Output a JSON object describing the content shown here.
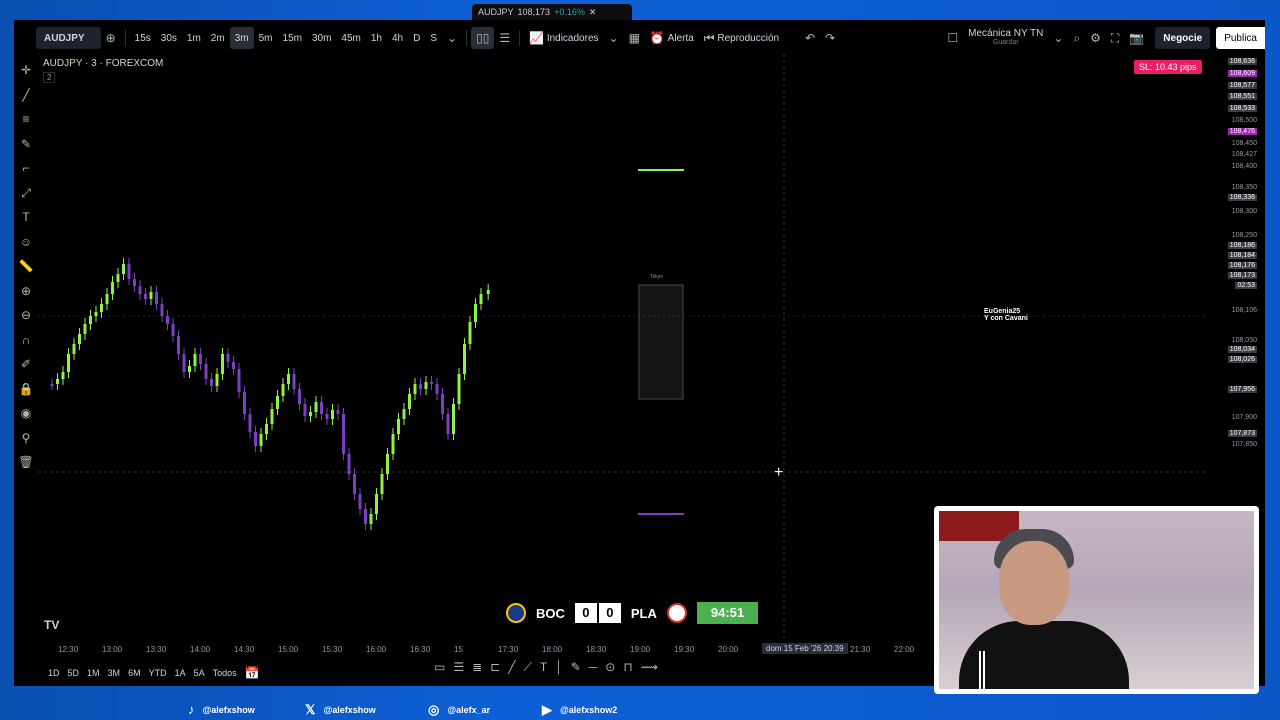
{
  "browser_tab": {
    "symbol": "AUDJPY",
    "price": "108,173",
    "change": "+0.16%"
  },
  "toolbar": {
    "symbol": "AUDJPY",
    "intervals": [
      "15s",
      "30s",
      "1m",
      "2m",
      "3m",
      "5m",
      "15m",
      "30m",
      "45m",
      "1h",
      "4h",
      "D",
      "S"
    ],
    "active_interval": "3m",
    "indicators_label": "Indicadores",
    "alert_label": "Alerta",
    "replay_label": "Reproducción",
    "layout_name": "Mecánica NY TN",
    "layout_sub": "Guardar",
    "trade_label": "Negocie",
    "publish_label": "Publica"
  },
  "chart": {
    "title": "AUDJPY · 3 · FOREXCOM",
    "sub": "2",
    "sl_badge": "SL: 10.43 pips",
    "watermark": "TV",
    "user_label": "EuGenia25",
    "user_label2": "Y con Cavani",
    "box_label": "Tokyo",
    "cursor_date": "dom 15 Feb '26  20:39"
  },
  "price_axis": [
    {
      "label": "108,636",
      "style": "box"
    },
    {
      "label": "108,609",
      "style": "purple"
    },
    {
      "label": "108,577",
      "style": "box"
    },
    {
      "label": "108,551",
      "style": "box"
    },
    {
      "label": "108,533",
      "style": "box"
    },
    {
      "label": "108,500",
      "style": "plain"
    },
    {
      "label": "108,476",
      "style": "purple"
    },
    {
      "label": "108,450",
      "style": "plain"
    },
    {
      "label": "108,427",
      "style": "plain"
    },
    {
      "label": "108,400",
      "style": "plain"
    },
    {
      "label": "108,350",
      "style": "plain"
    },
    {
      "label": "108,336",
      "style": "box"
    },
    {
      "label": "108,300",
      "style": "plain"
    },
    {
      "label": "108,250",
      "style": "plain"
    },
    {
      "label": "108,186",
      "style": "box"
    },
    {
      "label": "108,184",
      "style": "box"
    },
    {
      "label": "108,176",
      "style": "box"
    },
    {
      "label": "108,173",
      "style": "box"
    },
    {
      "label": "02:53",
      "style": "box"
    },
    {
      "label": "108,106",
      "style": "plain"
    },
    {
      "label": "108,050",
      "style": "plain"
    },
    {
      "label": "108,034",
      "style": "box"
    },
    {
      "label": "108,026",
      "style": "box"
    },
    {
      "label": "107,956",
      "style": "box"
    },
    {
      "label": "107,900",
      "style": "plain"
    },
    {
      "label": "107,873",
      "style": "box"
    },
    {
      "label": "107,850",
      "style": "plain"
    }
  ],
  "time_axis": [
    "12:30",
    "13:00",
    "13:30",
    "14:00",
    "14:30",
    "15:00",
    "15:30",
    "16:00",
    "16:30",
    "15",
    "17:30",
    "18:00",
    "18:30",
    "19:00",
    "19:30",
    "20:00",
    "21:30",
    "22:00"
  ],
  "bottom_ranges": [
    "1D",
    "5D",
    "1M",
    "3M",
    "6M",
    "YTD",
    "1A",
    "5A",
    "Todos"
  ],
  "scoreboard": {
    "home": "BOC",
    "home_score": "0",
    "away_score": "0",
    "away": "PLA",
    "clock": "94:51"
  },
  "socials": [
    {
      "icon": "tiktok-icon",
      "handle": "@alefxshow"
    },
    {
      "icon": "x-icon",
      "handle": "@alefxshow"
    },
    {
      "icon": "instagram-icon",
      "handle": "@alefx_ar"
    },
    {
      "icon": "youtube-icon",
      "handle": "@alefxshow2"
    }
  ],
  "colors": {
    "bull": "#8ef24a",
    "bear": "#7b3fc4",
    "sl_badge": "#e91e63",
    "frame": "#0e5fd6",
    "clock": "#4caf50"
  }
}
